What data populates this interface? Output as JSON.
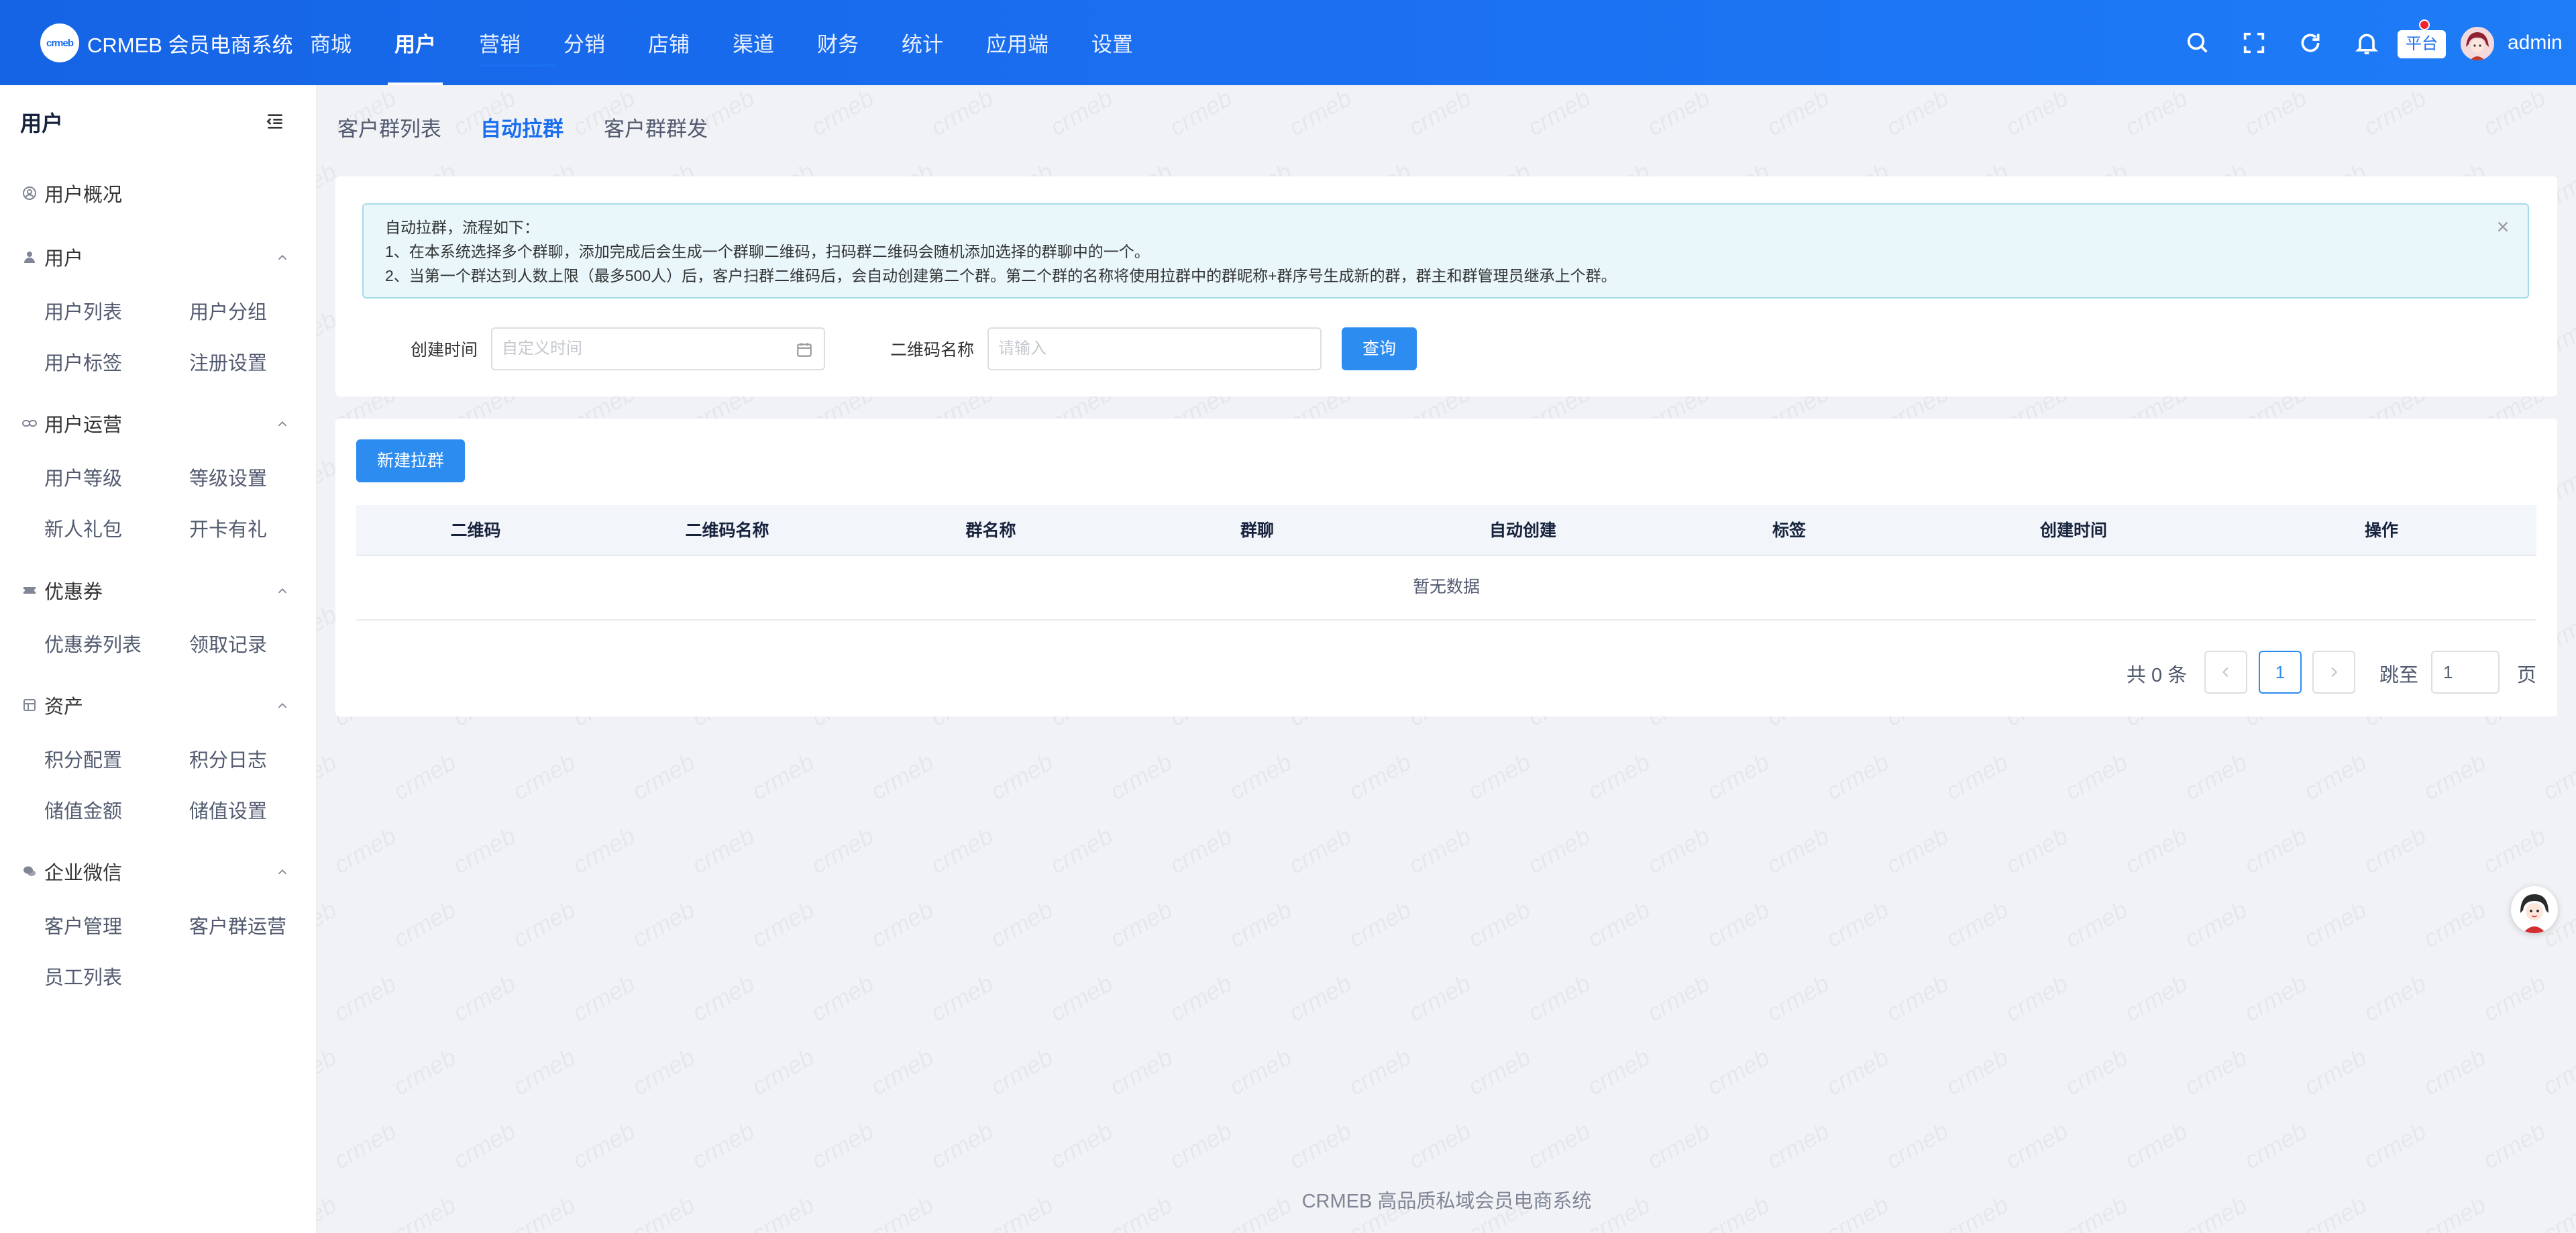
{
  "app": {
    "logo_mark": "crmeb",
    "title": "CRMEB 会员电商系统"
  },
  "topnav": [
    {
      "label": "商城"
    },
    {
      "label": "用户"
    },
    {
      "label": "营销"
    },
    {
      "label": "分销"
    },
    {
      "label": "店铺"
    },
    {
      "label": "渠道"
    },
    {
      "label": "财务"
    },
    {
      "label": "统计"
    },
    {
      "label": "应用端"
    },
    {
      "label": "设置"
    }
  ],
  "topnav_active": "用户",
  "header": {
    "icons": [
      "search-icon",
      "fullscreen-icon",
      "refresh-icon",
      "bell-icon"
    ],
    "platform_label": "平台",
    "username": "admin"
  },
  "sidebar": {
    "title": "用户",
    "groups": [
      {
        "label": "用户概况",
        "icon": "user-circle-icon",
        "items": []
      },
      {
        "label": "用户",
        "icon": "user-icon",
        "items": [
          "用户列表",
          "用户分组",
          "用户标签",
          "注册设置"
        ]
      },
      {
        "label": "用户运营",
        "icon": "link-icon",
        "items": [
          "用户等级",
          "等级设置",
          "新人礼包",
          "开卡有礼"
        ]
      },
      {
        "label": "优惠券",
        "icon": "coupon-icon",
        "items": [
          "优惠券列表",
          "领取记录"
        ]
      },
      {
        "label": "资产",
        "icon": "asset-icon",
        "items": [
          "积分配置",
          "积分日志",
          "储值金额",
          "储值设置"
        ]
      },
      {
        "label": "企业微信",
        "icon": "wechat-icon",
        "items": [
          "客户管理",
          "客户群运营",
          "员工列表"
        ]
      }
    ]
  },
  "tabs": [
    {
      "label": "客户群列表"
    },
    {
      "label": "自动拉群"
    },
    {
      "label": "客户群群发"
    }
  ],
  "tab_active": "自动拉群",
  "alert": {
    "lines": [
      "自动拉群，流程如下：",
      "1、在本系统选择多个群聊，添加完成后会生成一个群聊二维码，扫码群二维码会随机添加选择的群聊中的一个。",
      "2、当第一个群达到人数上限（最多500人）后，客户扫群二维码后，会自动创建第二个群。第二个群的名称将使用拉群中的群昵称+群序号生成新的群，群主和群管理员继承上个群。"
    ]
  },
  "filters": {
    "created_label": "创建时间",
    "created_placeholder": "自定义时间",
    "qr_label": "二维码名称",
    "qr_placeholder": "请输入",
    "query_button": "查询"
  },
  "actions": {
    "new_button": "新建拉群"
  },
  "table": {
    "columns": [
      "二维码",
      "二维码名称",
      "群名称",
      "群聊",
      "自动创建",
      "标签",
      "创建时间",
      "操作"
    ],
    "rows": [],
    "empty_text": "暂无数据"
  },
  "pagination": {
    "total_text": "共 0 条",
    "current_page": "1",
    "jump_label": "跳至",
    "jump_value": "1",
    "page_suffix": "页"
  },
  "footer": {
    "text": "CRMEB 高品质私域会员电商系统"
  },
  "watermark": {
    "text": "crmeb"
  },
  "colors": {
    "primary": "#2d8cf0",
    "header": "#1a6ef0",
    "alert_bg": "#e9f7fb",
    "alert_border": "#a5dbe9"
  }
}
